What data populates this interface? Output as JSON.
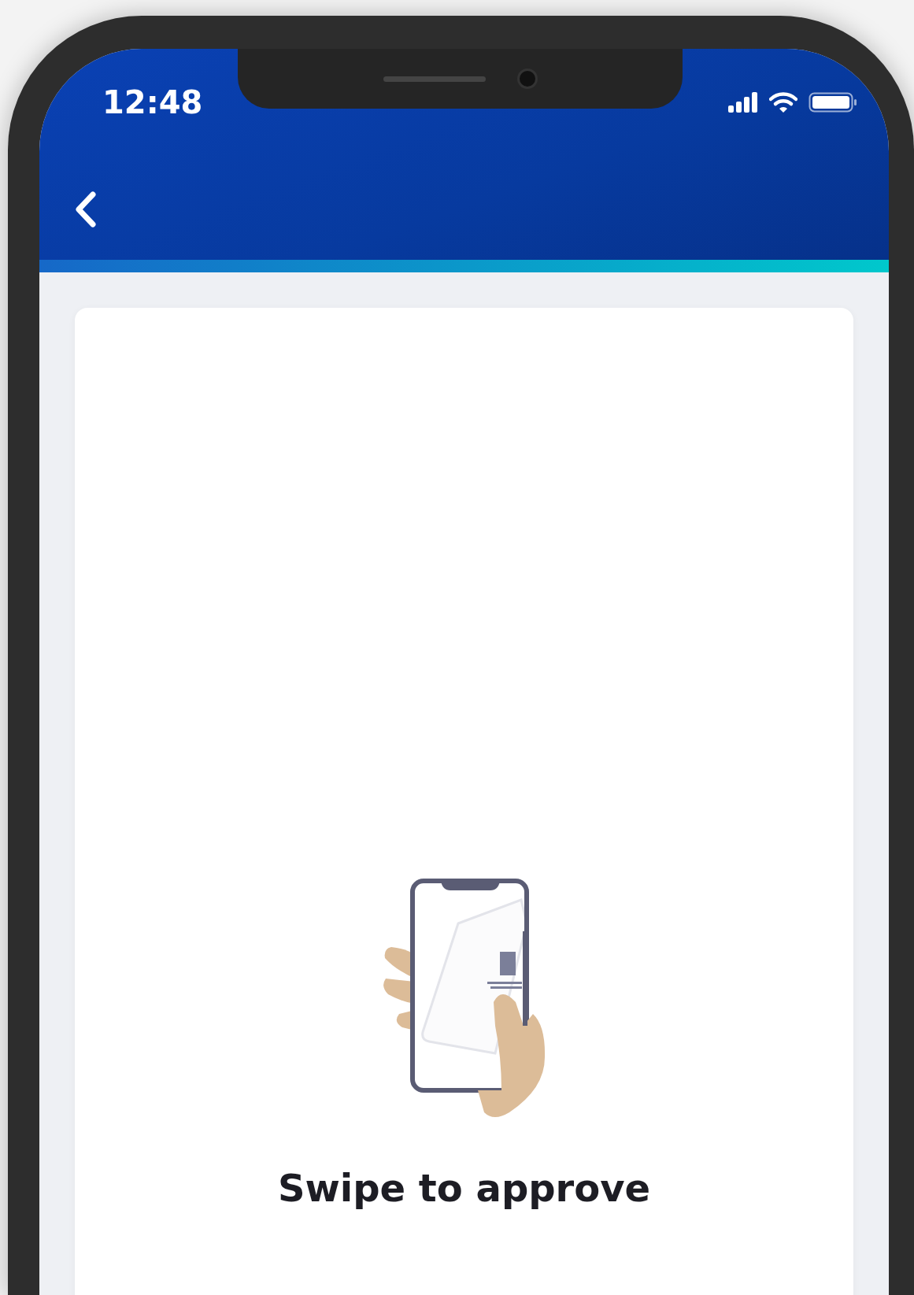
{
  "status_bar": {
    "time": "12:48"
  },
  "card": {
    "title": "Swipe to approve"
  }
}
